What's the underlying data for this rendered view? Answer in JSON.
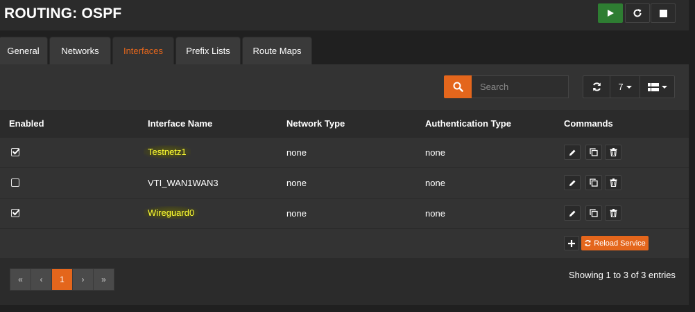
{
  "page": {
    "title": "ROUTING: OSPF"
  },
  "header_buttons": [
    {
      "name": "play-icon",
      "color": "#2e7d32"
    },
    {
      "name": "restart-icon"
    },
    {
      "name": "stop-icon"
    }
  ],
  "tabs": [
    {
      "label": "General",
      "active": false
    },
    {
      "label": "Networks",
      "active": false
    },
    {
      "label": "Interfaces",
      "active": true
    },
    {
      "label": "Prefix Lists",
      "active": false
    },
    {
      "label": "Route Maps",
      "active": false
    }
  ],
  "toolbar": {
    "search_placeholder": "Search",
    "rows_per_page": "7"
  },
  "table": {
    "columns": [
      "Enabled",
      "Interface Name",
      "Network Type",
      "Authentication Type",
      "Commands"
    ],
    "rows": [
      {
        "enabled": true,
        "interface": "Testnetz1",
        "network_type": "none",
        "auth_type": "none",
        "highlighted": true
      },
      {
        "enabled": false,
        "interface": "VTI_WAN1WAN3",
        "network_type": "none",
        "auth_type": "none",
        "highlighted": false
      },
      {
        "enabled": true,
        "interface": "Wireguard0",
        "network_type": "none",
        "auth_type": "none",
        "highlighted": true
      }
    ]
  },
  "actions": {
    "reload_label": "Reload Service"
  },
  "pagination": {
    "first": "«",
    "prev": "‹",
    "current": "1",
    "next": "›",
    "last": "»",
    "summary": "Showing 1 to 3 of 3 entries"
  },
  "colors": {
    "accent": "#e4661c",
    "highlight_text": "#ffff33",
    "start_green": "#2e7d32"
  }
}
